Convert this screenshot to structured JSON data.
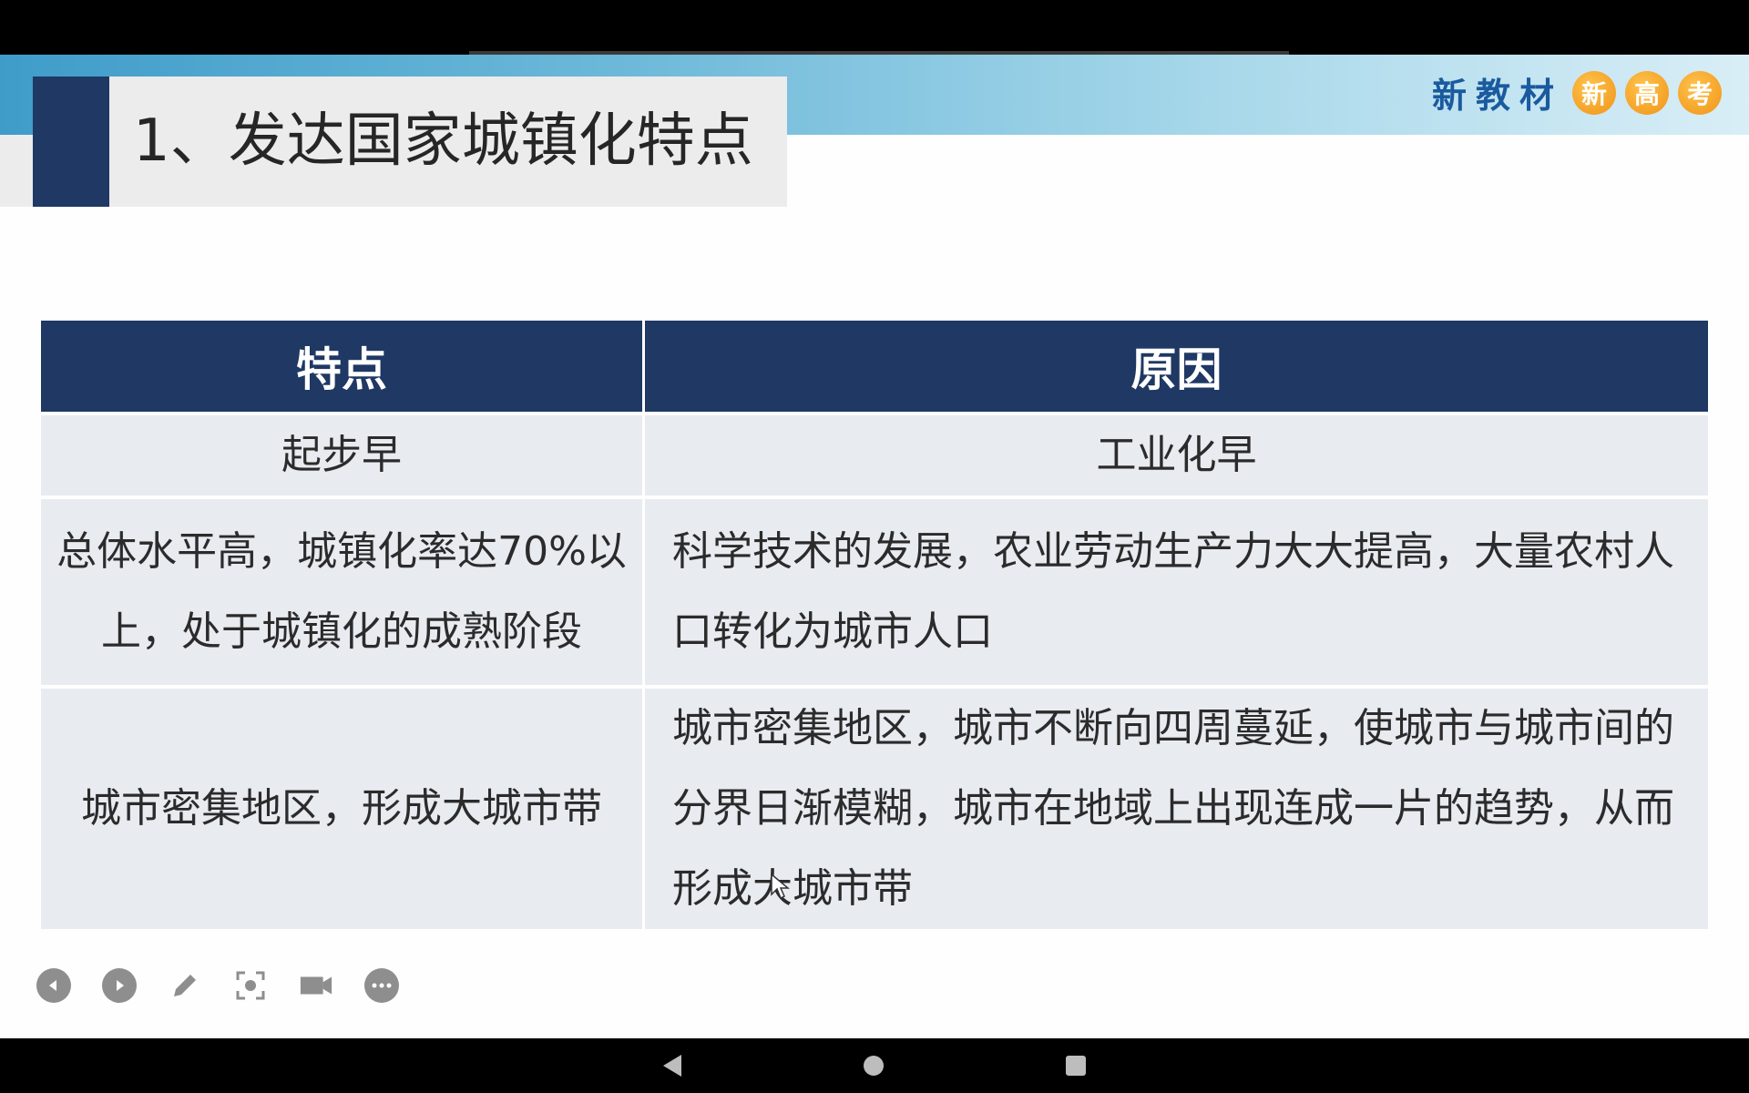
{
  "slide": {
    "title": "1、发达国家城镇化特点",
    "brand": {
      "text": "新教材",
      "circles": [
        "新",
        "高",
        "考"
      ],
      "color": "#1a5a9e"
    }
  },
  "table": {
    "headers": [
      "特点",
      "原因"
    ],
    "rows": [
      {
        "feature": "起步早",
        "reason": "工业化早"
      },
      {
        "feature": "总体水平高，城镇化率达70%以上，处于城镇化的成熟阶段",
        "reason": "科学技术的发展，农业劳动生产力大大提高，大量农村人口转化为城市人口"
      },
      {
        "feature": "城市密集地区，形成大城市带",
        "reason": "城市密集地区，城市不断向四周蔓延，使城市与城市间的分界日渐模糊，城市在地域上出现连成一片的趋势，从而形成大城市带"
      }
    ],
    "header_color": "#1f3864"
  },
  "toolbar": {
    "icons": [
      "prev-slide-icon",
      "next-slide-icon",
      "pen-icon",
      "screenshot-icon",
      "camera-icon",
      "more-icon"
    ]
  },
  "navbar": {
    "icons": [
      "back-icon",
      "home-icon",
      "recent-apps-icon"
    ]
  }
}
